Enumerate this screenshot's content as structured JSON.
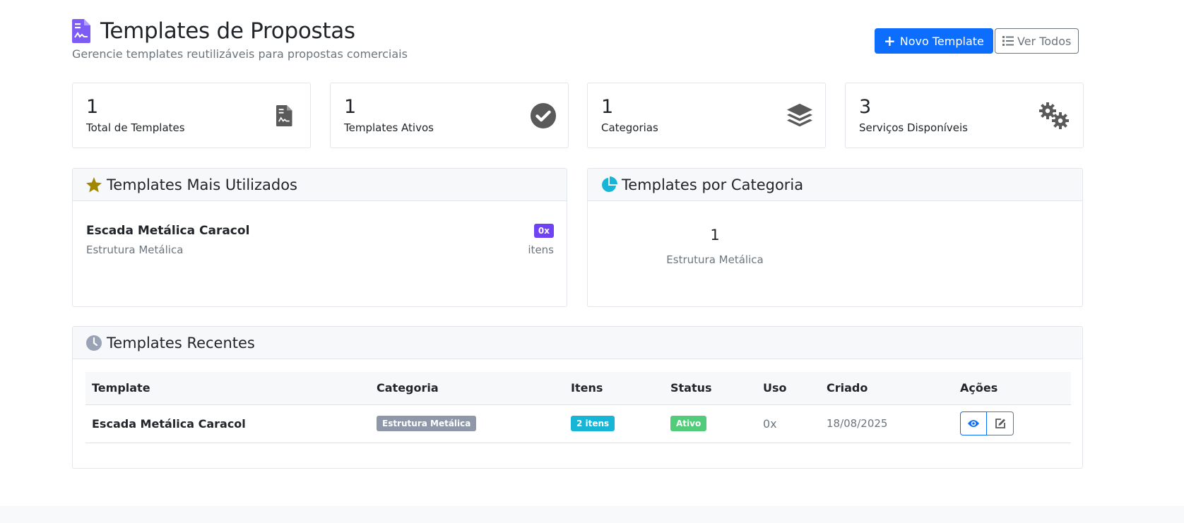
{
  "header": {
    "title": "Templates de Propostas",
    "subtitle": "Gerencie templates reutilizáveis para propostas comerciais",
    "new_button": "Novo Template",
    "view_all_button": "Ver Todos"
  },
  "stats": [
    {
      "value": "1",
      "label": "Total de Templates",
      "icon": "file-contract-icon"
    },
    {
      "value": "1",
      "label": "Templates Ativos",
      "icon": "check-circle-icon"
    },
    {
      "value": "1",
      "label": "Categorias",
      "icon": "layers-icon"
    },
    {
      "value": "3",
      "label": "Serviços Disponíveis",
      "icon": "gears-icon"
    }
  ],
  "most_used": {
    "title": "Templates Mais Utilizados",
    "items": [
      {
        "name": "Escada Metálica Caracol",
        "category": "Estrutura Metálica",
        "uses": "0x",
        "items_label": "itens"
      }
    ]
  },
  "by_category": {
    "title": "Templates por Categoria",
    "items": [
      {
        "count": "1",
        "name": "Estrutura Metálica"
      }
    ]
  },
  "recent": {
    "title": "Templates Recentes",
    "columns": [
      "Template",
      "Categoria",
      "Itens",
      "Status",
      "Uso",
      "Criado",
      "Ações"
    ],
    "rows": [
      {
        "template": "Escada Metálica Caracol",
        "category": "Estrutura Metálica",
        "items": "2 itens",
        "status": "Ativo",
        "usage": "0x",
        "created": "18/08/2025"
      }
    ]
  },
  "colors": {
    "primary": "#0d6efd",
    "purple": "#6f42f5",
    "cyan": "#17b5d6",
    "green": "#52cc7a",
    "gold": "#a08800"
  }
}
